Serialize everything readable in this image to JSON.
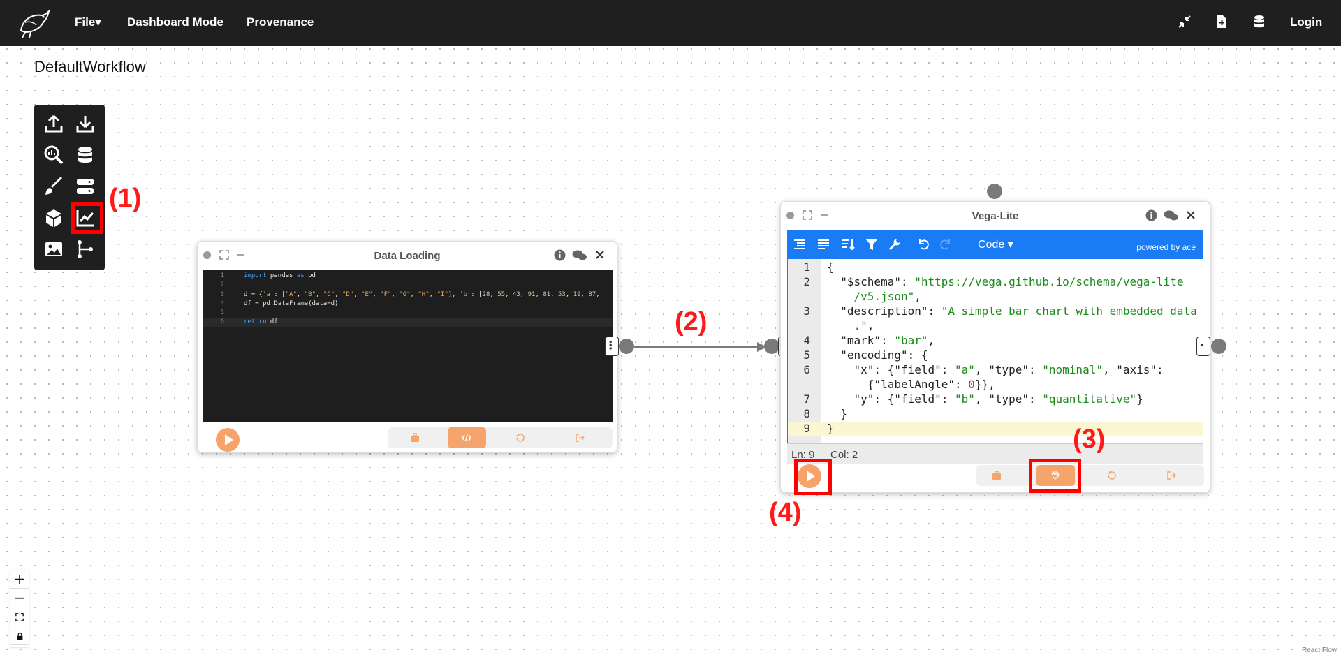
{
  "nav": {
    "file": "File▾",
    "dashboard_mode": "Dashboard Mode",
    "provenance": "Provenance",
    "login": "Login",
    "icons": [
      "compress-icon",
      "file-plus-icon",
      "database-icon"
    ]
  },
  "workflow": {
    "title": "DefaultWorkflow"
  },
  "palette": {
    "tools": [
      "upload-icon",
      "download-icon",
      "analyze-search-icon",
      "database-icon",
      "brush-icon",
      "server-icon",
      "cube-icon",
      "line-chart-icon",
      "image-icon",
      "merge-branch-icon"
    ]
  },
  "annotations": {
    "a1": "(1)",
    "a2": "(2)",
    "a3": "(3)",
    "a4": "(4)"
  },
  "data_loading": {
    "title": "Data Loading",
    "code": [
      {
        "n": "1",
        "text": "import pandas as pd"
      },
      {
        "n": "2",
        "text": ""
      },
      {
        "n": "3",
        "text": "d = {'a': [\"A\", \"B\", \"C\", \"D\", \"E\", \"F\", \"G\", \"H\", \"I\"], 'b': [28, 55, 43, 91, 81, 53, 19, 87,"
      },
      {
        "n": "4",
        "text": "df = pd.DataFrame(data=d)"
      },
      {
        "n": "5",
        "text": ""
      },
      {
        "n": "6",
        "text": "return df"
      }
    ]
  },
  "vega": {
    "title": "Vega-Lite",
    "code_menu": "Code ▾",
    "powered_by": "powered by ace",
    "lines": [
      {
        "n": "1",
        "text": "{"
      },
      {
        "n": "2",
        "text": "  \"$schema\": \"https://vega.github.io/schema/vega-lite"
      },
      {
        "n": "",
        "text": "    /v5.json\","
      },
      {
        "n": "3",
        "text": "  \"description\": \"A simple bar chart with embedded data"
      },
      {
        "n": "",
        "text": "    .\","
      },
      {
        "n": "4",
        "text": "  \"mark\": \"bar\","
      },
      {
        "n": "5",
        "text": "  \"encoding\": {"
      },
      {
        "n": "6",
        "text": "    \"x\": {\"field\": \"a\", \"type\": \"nominal\", \"axis\":"
      },
      {
        "n": "",
        "text": "      {\"labelAngle\": 0}},"
      },
      {
        "n": "7",
        "text": "    \"y\": {\"field\": \"b\", \"type\": \"quantitative\"}"
      },
      {
        "n": "8",
        "text": "  }"
      },
      {
        "n": "9",
        "text": "}"
      }
    ],
    "status_ln": "Ln: 9",
    "status_col": "Col: 2"
  },
  "zoom": {
    "in": "+",
    "out": "−"
  },
  "attribution": "React Flow"
}
